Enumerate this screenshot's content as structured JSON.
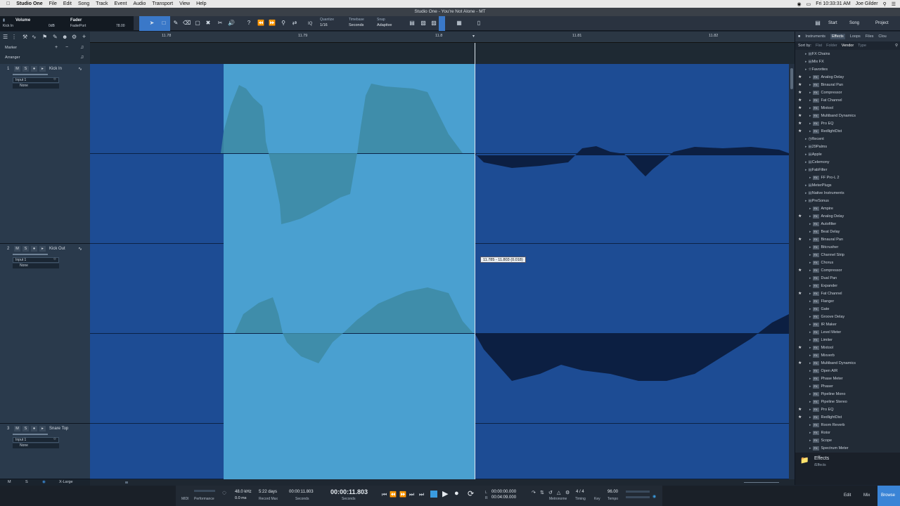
{
  "menubar": {
    "app": "Studio One",
    "items": [
      "File",
      "Edit",
      "Song",
      "Track",
      "Event",
      "Audio",
      "Transport",
      "View",
      "Help"
    ],
    "clock": "Fri 10:33:31 AM",
    "user": "Joe Gilder"
  },
  "window_title": "Studio One - You're Not Alone - MT",
  "toolbar": {
    "info_volume_label": "Volume",
    "info_volume_value": "0dB",
    "info_track": "Kick In",
    "info_fader_label": "Fader",
    "info_fader_port": "FaderPort",
    "info_fader_value": "78.00",
    "quantize_label": "Quantize",
    "quantize_value": "1/16",
    "timebase_label": "Timebase",
    "timebase_value": "Seconds",
    "snap_label": "Snap",
    "snap_value": "Adaptive",
    "iq": "IQ",
    "start": "Start",
    "song": "Song",
    "project": "Project"
  },
  "ruler": {
    "ticks": [
      "11.78",
      "11.79",
      "11.8",
      "11.81",
      "11.82"
    ]
  },
  "global_tracks": {
    "marker": "Marker",
    "arranger": "Arranger"
  },
  "tracks": [
    {
      "number": "1",
      "name": "Kick In",
      "input": "Input 1",
      "output": "None"
    },
    {
      "number": "2",
      "name": "Kick Out",
      "input": "Input 1",
      "output": "None"
    },
    {
      "number": "3",
      "name": "Snare Top",
      "input": "Input 1",
      "output": "None"
    }
  ],
  "track_buttons": {
    "mute": "M",
    "solo": "S"
  },
  "range_tooltip": "11.785 - 11.803 (0.018)",
  "browser": {
    "tabs": [
      "Instruments",
      "Effects",
      "Loops",
      "Files",
      "Clou"
    ],
    "active_tab": "Effects",
    "sort_label": "Sort by:",
    "sort_options": [
      "Flat",
      "Folder",
      "Vendor",
      "Type"
    ],
    "items": [
      {
        "label": "FX Chains",
        "kind": "folder",
        "star": false,
        "indent": 1
      },
      {
        "label": "Mix FX",
        "kind": "folder",
        "star": false,
        "indent": 1
      },
      {
        "label": "Favorites",
        "kind": "favfolder",
        "star": false,
        "indent": 1
      },
      {
        "label": "Analog Delay",
        "kind": "fx",
        "star": true,
        "indent": 2
      },
      {
        "label": "Binaural Pan",
        "kind": "fx",
        "star": true,
        "indent": 2
      },
      {
        "label": "Compressor",
        "kind": "fx",
        "star": true,
        "indent": 2
      },
      {
        "label": "Fat Channel",
        "kind": "fx",
        "star": true,
        "indent": 2
      },
      {
        "label": "Mixtool",
        "kind": "fx",
        "star": true,
        "indent": 2
      },
      {
        "label": "Multiband Dynamics",
        "kind": "fx",
        "star": true,
        "indent": 2
      },
      {
        "label": "Pro EQ",
        "kind": "fx",
        "star": true,
        "indent": 2
      },
      {
        "label": "RedlightDist",
        "kind": "fx",
        "star": true,
        "indent": 2
      },
      {
        "label": "Recent",
        "kind": "recent",
        "star": false,
        "indent": 1
      },
      {
        "label": "29Palms",
        "kind": "folder",
        "star": false,
        "indent": 1
      },
      {
        "label": "Apple",
        "kind": "folder",
        "star": false,
        "indent": 1
      },
      {
        "label": "Celemony",
        "kind": "folder",
        "star": false,
        "indent": 1
      },
      {
        "label": "FabFilter",
        "kind": "folder",
        "star": false,
        "indent": 1
      },
      {
        "label": "FF Pro-L 2",
        "kind": "fx",
        "star": false,
        "indent": 2
      },
      {
        "label": "MeterPlugs",
        "kind": "folder",
        "star": false,
        "indent": 1
      },
      {
        "label": "Native Instruments",
        "kind": "folder",
        "star": false,
        "indent": 1
      },
      {
        "label": "PreSonus",
        "kind": "presonus",
        "star": false,
        "indent": 1
      },
      {
        "label": "Ampire",
        "kind": "fx",
        "star": false,
        "indent": 2
      },
      {
        "label": "Analog Delay",
        "kind": "fx",
        "star": true,
        "indent": 2
      },
      {
        "label": "Autofilter",
        "kind": "fx",
        "star": false,
        "indent": 2
      },
      {
        "label": "Beat Delay",
        "kind": "fx",
        "star": false,
        "indent": 2
      },
      {
        "label": "Binaural Pan",
        "kind": "fx",
        "star": true,
        "indent": 2
      },
      {
        "label": "Bitcrusher",
        "kind": "fx",
        "star": false,
        "indent": 2
      },
      {
        "label": "Channel Strip",
        "kind": "fx",
        "star": false,
        "indent": 2
      },
      {
        "label": "Chorus",
        "kind": "fx",
        "star": false,
        "indent": 2
      },
      {
        "label": "Compressor",
        "kind": "fx",
        "star": true,
        "indent": 2
      },
      {
        "label": "Dual Pan",
        "kind": "fx",
        "star": false,
        "indent": 2
      },
      {
        "label": "Expander",
        "kind": "fx",
        "star": false,
        "indent": 2
      },
      {
        "label": "Fat Channel",
        "kind": "fx",
        "star": true,
        "indent": 2
      },
      {
        "label": "Flanger",
        "kind": "fx",
        "star": false,
        "indent": 2
      },
      {
        "label": "Gate",
        "kind": "fx",
        "star": false,
        "indent": 2
      },
      {
        "label": "Groove Delay",
        "kind": "fx",
        "star": false,
        "indent": 2
      },
      {
        "label": "IR Maker",
        "kind": "fx",
        "star": false,
        "indent": 2
      },
      {
        "label": "Level Meter",
        "kind": "fx",
        "star": false,
        "indent": 2
      },
      {
        "label": "Limiter",
        "kind": "fx",
        "star": false,
        "indent": 2
      },
      {
        "label": "Mixtool",
        "kind": "fx",
        "star": true,
        "indent": 2
      },
      {
        "label": "Mixverb",
        "kind": "fx",
        "star": false,
        "indent": 2
      },
      {
        "label": "Multiband Dynamics",
        "kind": "fx",
        "star": true,
        "indent": 2
      },
      {
        "label": "Open AIR",
        "kind": "fx",
        "star": false,
        "indent": 2
      },
      {
        "label": "Phase Meter",
        "kind": "fx",
        "star": false,
        "indent": 2
      },
      {
        "label": "Phaser",
        "kind": "fx",
        "star": false,
        "indent": 2
      },
      {
        "label": "Pipeline Mono",
        "kind": "fx",
        "star": false,
        "indent": 2
      },
      {
        "label": "Pipeline Stereo",
        "kind": "fx",
        "star": false,
        "indent": 2
      },
      {
        "label": "Pro EQ",
        "kind": "fx",
        "star": true,
        "indent": 2
      },
      {
        "label": "RedlightDist",
        "kind": "fx",
        "star": true,
        "indent": 2
      },
      {
        "label": "Room Reverb",
        "kind": "fx",
        "star": false,
        "indent": 2
      },
      {
        "label": "Rotor",
        "kind": "fx",
        "star": false,
        "indent": 2
      },
      {
        "label": "Scope",
        "kind": "fx",
        "star": false,
        "indent": 2
      },
      {
        "label": "Spectrum Meter",
        "kind": "fx",
        "star": false,
        "indent": 2
      }
    ],
    "footer_title": "Effects",
    "footer_path": "/Effects"
  },
  "bottom_left": {
    "m": "M",
    "s": "S",
    "zoom": "X-Large"
  },
  "transport": {
    "midi": "MIDI",
    "performance": "Performance",
    "sample_rate": "48.0 kHz",
    "latency": "0.0 ms",
    "record_max_value": "5:22 days",
    "record_max_label": "Record Max",
    "sec_value": "00:00:11.803",
    "sec_label": "Seconds",
    "main_time": "00:00:11.803",
    "main_label": "Seconds",
    "loop_l": "00:00:00.000",
    "loop_r": "00:04:09.000",
    "l": "L",
    "r": "R",
    "metronome": "Metronome",
    "timing_value": "4 / 4",
    "timing_label": "Timing",
    "key_label": "Key",
    "tempo_value": "96.00",
    "tempo_label": "Tempo",
    "edit": "Edit",
    "mix": "Mix",
    "browse": "Browse"
  }
}
